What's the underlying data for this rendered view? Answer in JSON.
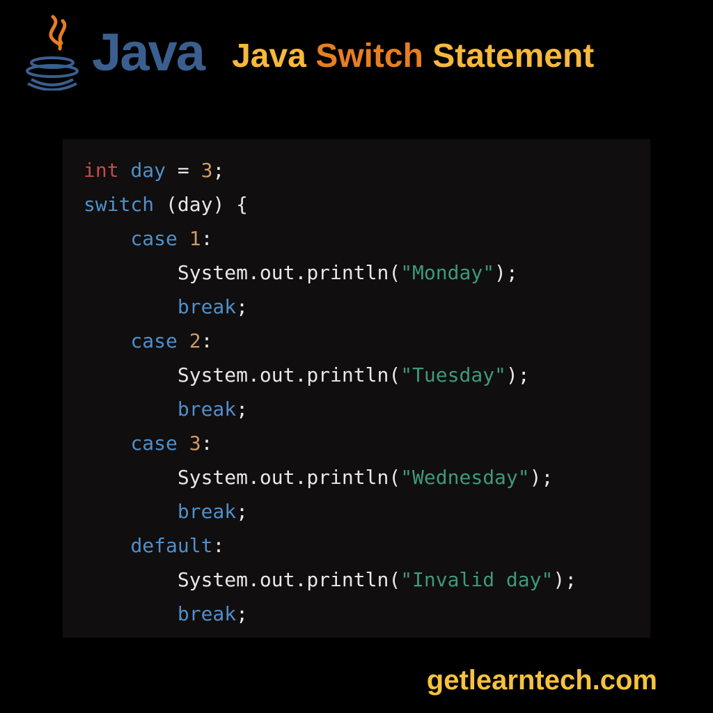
{
  "header": {
    "wordmark": "Java",
    "title_w1": "Java",
    "title_w2": "Switch",
    "title_w3": "Statement"
  },
  "code": {
    "type_kw": "int",
    "var_day": "day",
    "assign": "=",
    "val_3": "3",
    "semi": ";",
    "switch_kw": "switch",
    "lparen": "(",
    "rparen": ")",
    "lbrace": "{",
    "case_kw": "case",
    "num1": "1",
    "num2": "2",
    "num3": "3",
    "colon": ":",
    "sys": "System",
    "dot": ".",
    "out": "out",
    "println": "println",
    "str_mon": "\"Monday\"",
    "str_tue": "\"Tuesday\"",
    "str_wed": "\"Wednesday\"",
    "str_inv": "\"Invalid day\"",
    "break_kw": "break",
    "default_kw": "default"
  },
  "footer": {
    "site": "getlearntech.com"
  },
  "colors": {
    "accent_yellow": "#f6b93b",
    "accent_orange": "#e67e22",
    "logo_blue": "#3a5f8f",
    "code_bg": "#100e0e"
  }
}
